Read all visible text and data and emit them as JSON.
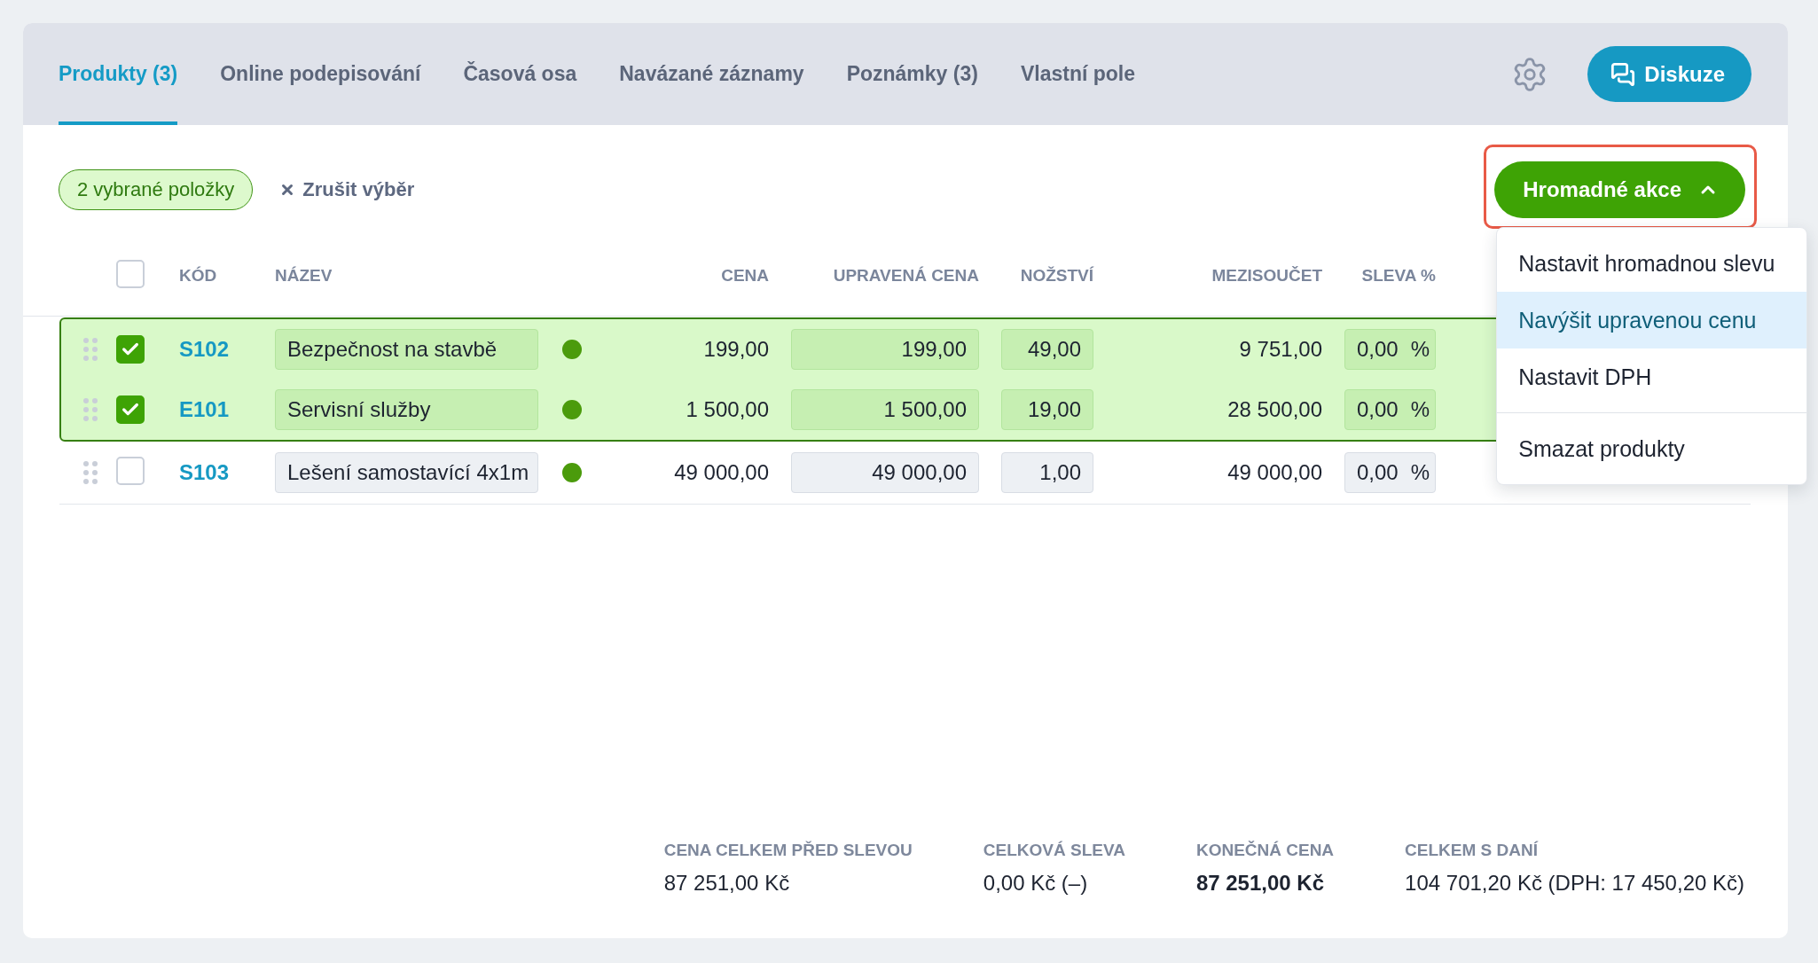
{
  "tabs": [
    {
      "label": "Produkty (3)",
      "selected": true
    },
    {
      "label": "Online podepisování",
      "selected": false
    },
    {
      "label": "Časová osa",
      "selected": false
    },
    {
      "label": "Navázané záznamy",
      "selected": false
    },
    {
      "label": "Poznámky (3)",
      "selected": false
    },
    {
      "label": "Vlastní pole",
      "selected": false
    }
  ],
  "discussion_button": {
    "label": "Diskuze"
  },
  "selection": {
    "count_badge": "2 vybrané položky",
    "clear_label": "Zrušit výběr"
  },
  "bulk_actions": {
    "label": "Hromadné akce",
    "expanded": true,
    "annotated": true,
    "menu": {
      "groups": [
        {
          "items": [
            {
              "label": "Nastavit hromadnou slevu",
              "highlighted": false
            },
            {
              "label": "Navýšit upravenou cenu",
              "highlighted": true
            },
            {
              "label": "Nastavit DPH",
              "highlighted": false
            }
          ]
        },
        {
          "items": [
            {
              "label": "Smazat produkty",
              "highlighted": false
            }
          ]
        }
      ]
    }
  },
  "table": {
    "select_all": {
      "checked": false
    },
    "columns": [
      "KÓD",
      "NÁZEV",
      "CENA",
      "UPRAVENÁ CENA",
      "NOŽSTVÍ",
      "MEZISOUČET",
      "SLEVA %"
    ],
    "rows": [
      {
        "selected": true,
        "code": "S102",
        "name": "Bezpečnost na stavbě",
        "color": "#4b9b0c",
        "price": "199,00",
        "adjusted_price": "199,00",
        "quantity": "49,00",
        "subtotal": "9 751,00",
        "discount": {
          "value": "0,00",
          "unit": "%"
        }
      },
      {
        "selected": true,
        "code": "E101",
        "name": "Servisní služby",
        "color": "#4b9b0c",
        "price": "1 500,00",
        "adjusted_price": "1 500,00",
        "quantity": "19,00",
        "subtotal": "28 500,00",
        "discount": {
          "value": "0,00",
          "unit": "%"
        }
      },
      {
        "selected": false,
        "code": "S103",
        "name": "Lešení samostavící 4x1m",
        "color": "#4b9b0c",
        "price": "49 000,00",
        "adjusted_price": "49 000,00",
        "quantity": "1,00",
        "subtotal": "49 000,00",
        "discount": {
          "value": "0,00",
          "unit": "%"
        }
      }
    ]
  },
  "totals": [
    {
      "label": "CENA CELKEM PŘED SLEVOU",
      "value": "87 251,00 Kč",
      "emphasis": false
    },
    {
      "label": "CELKOVÁ SLEVA",
      "value": "0,00 Kč (–)",
      "emphasis": false
    },
    {
      "label": "KONEČNÁ CENA",
      "value": "87 251,00 Kč",
      "emphasis": true
    },
    {
      "label": "CELKEM S DANÍ",
      "value": "104 701,20 Kč (DPH: 17 450,20 Kč)",
      "emphasis": false
    }
  ]
}
